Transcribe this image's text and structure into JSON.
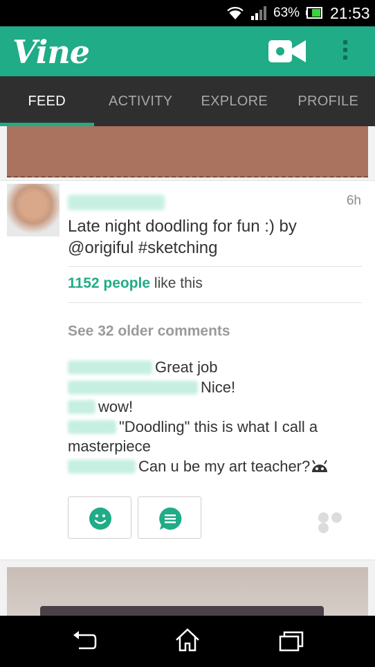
{
  "status_bar": {
    "battery_percent": "63%",
    "time": "21:53",
    "icons": [
      "wifi-icon",
      "signal-icon",
      "battery-icon"
    ]
  },
  "app_bar": {
    "logo": "Vine",
    "icons": [
      "video-camera-icon",
      "overflow-menu-icon"
    ],
    "accent_color": "#1fac86"
  },
  "tabs": [
    {
      "label": "FEED",
      "active": true
    },
    {
      "label": "ACTIVITY",
      "active": false
    },
    {
      "label": "EXPLORE",
      "active": false
    },
    {
      "label": "PROFILE",
      "active": false
    }
  ],
  "post": {
    "time_ago": "6h",
    "caption": "Late night doodling for fun :) by @origiful #sketching",
    "likes_count": "1152 people",
    "likes_suffix": " like this",
    "older_comments": "See 32 older comments",
    "comments": [
      {
        "text": "Great job"
      },
      {
        "text": "Nice!"
      },
      {
        "text": "wow!"
      },
      {
        "text": "\"Doodling\" this is what I call a masterpiece"
      },
      {
        "text": "Can u be my art teacher?"
      }
    ],
    "action_icons": [
      "smiley-icon",
      "comment-icon",
      "more-dots-icon"
    ]
  },
  "nav_bar": {
    "icons": [
      "back-icon",
      "home-icon",
      "recent-apps-icon"
    ]
  }
}
